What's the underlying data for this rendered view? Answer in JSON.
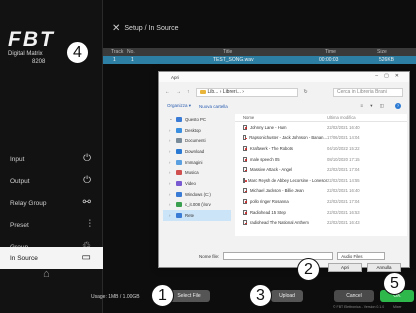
{
  "sidebar": {
    "logo": {
      "main": "FBT",
      "sub": "Digital Matrix",
      "model": "8208"
    },
    "items": [
      {
        "label": "Input",
        "icon": "input-icon",
        "glyph": "⏻"
      },
      {
        "label": "Output",
        "icon": "output-icon",
        "glyph": "⏻"
      },
      {
        "label": "Relay Group",
        "icon": "relay-group-icon",
        "glyph": "⚯"
      },
      {
        "label": "Preset",
        "icon": "preset-icon",
        "glyph": "⫶"
      },
      {
        "label": "Group",
        "icon": "group-icon",
        "glyph": "♲"
      },
      {
        "label": "In Source",
        "icon": "in-source-icon",
        "glyph": "▭",
        "active": true
      }
    ],
    "home_icon": "home-icon"
  },
  "header": {
    "title": "Setup / In Source",
    "icon": "tools-icon"
  },
  "table": {
    "columns": [
      "Track",
      "No.",
      "Title",
      "Time",
      "Size"
    ],
    "rows": [
      {
        "track": "1",
        "no": "1",
        "title": "TEST_SONG.wav",
        "time": "00:00:03",
        "size": "526KB"
      }
    ]
  },
  "dialog": {
    "title": "Apri",
    "address": {
      "path": "Lib... › Libreri... ›",
      "search_placeholder": "Cerca in Libreria Brani"
    },
    "toolbar": {
      "organize": "Organizza ▾",
      "new_folder": "Nuova cartella",
      "views": "≡ ▾ ◫",
      "help": "?"
    },
    "tree": [
      {
        "label": "Questo PC",
        "color": "#3a7bd5",
        "chev": "⌄",
        "selected": false
      },
      {
        "label": "Desktop",
        "color": "#3a8fe0",
        "chev": "›"
      },
      {
        "label": "Documenti",
        "color": "#7a8b9a",
        "chev": "›"
      },
      {
        "label": "Download",
        "color": "#2a7ad4",
        "chev": "›"
      },
      {
        "label": "Immagini",
        "color": "#5aa0e0",
        "chev": "›"
      },
      {
        "label": "Musica",
        "color": "#d05050",
        "chev": "›"
      },
      {
        "label": "Video",
        "color": "#7a5ad0",
        "chev": "›"
      },
      {
        "label": "Windows (C:)",
        "color": "#3a7bd5",
        "chev": "›"
      },
      {
        "label": "c_it.008 (\\\\srv",
        "color": "#3aa050",
        "chev": "›"
      },
      {
        "label": "Rete",
        "color": "#3a7bd5",
        "chev": "›",
        "selected": true
      }
    ],
    "file_columns": {
      "name": "Nome",
      "date": "Ultima modifica"
    },
    "files": [
      {
        "name": "Johnny Lane - Hum",
        "date": "22/02/2021 16:40"
      },
      {
        "name": "Rapsonichuster - Jack Johnson - Banan...",
        "date": "17/06/2021 14:04"
      },
      {
        "name": "Kraftwerk - The Robots",
        "date": "04/10/2022 15:22"
      },
      {
        "name": "male speech 05",
        "date": "08/10/2020 17:15"
      },
      {
        "name": "Massive Attack - Angel",
        "date": "22/02/2021 17:04"
      },
      {
        "name": "Marc Reysh de Abbey Lecorsine - Lonesome...",
        "date": "22/02/2021 14:55"
      },
      {
        "name": "Michael Jackson - Billie Jean",
        "date": "22/02/2021 16:40"
      },
      {
        "name": "pollo ringer Rosanna",
        "date": "22/02/2021 17:04"
      },
      {
        "name": "Radiohead 15 Step",
        "date": "22/02/2021 16:53"
      },
      {
        "name": "radiohead The National Anthem",
        "date": "22/02/2021 16:43"
      }
    ],
    "filename_label": "Nome file:",
    "type_filter": "Audio Files",
    "open_button": "Apri",
    "cancel_button": "Annulla"
  },
  "bottom": {
    "usage": "Usage: 1MB / 1.00GB",
    "select_file": "Select File",
    "upload": "Upload",
    "cancel": "Cancel",
    "ok": "OK",
    "footer_left": "© FBT Elettronica - Version 0.1.0",
    "footer_right": "Mixer"
  },
  "callouts": [
    "1",
    "2",
    "3",
    "4",
    "5"
  ],
  "colors": {
    "accent": "#2d7fa4",
    "ok": "#2eb84c"
  }
}
